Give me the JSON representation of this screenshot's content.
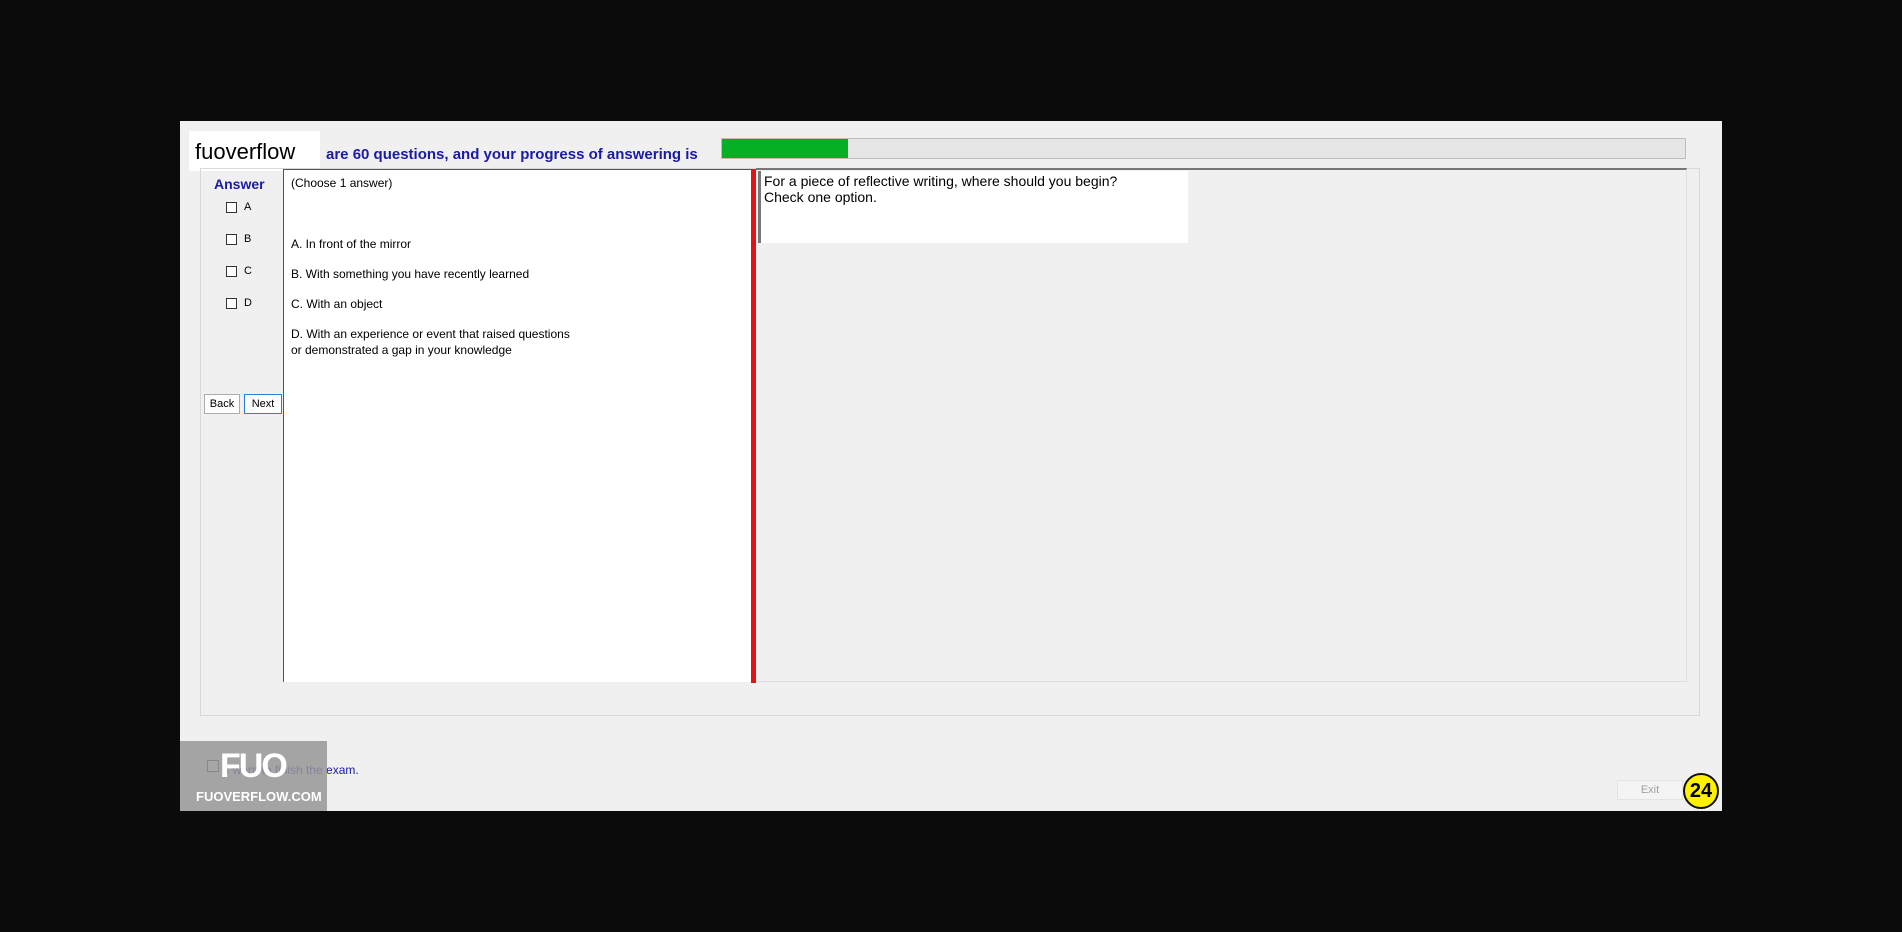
{
  "header": {
    "progress_text": "are 60 questions, and your progress of answering is",
    "progress_fraction": 0.131,
    "logo_text": "fuoverflow"
  },
  "answer": {
    "label": "Answer",
    "options": [
      "A",
      "B",
      "C",
      "D"
    ]
  },
  "nav": {
    "back_label": "Back",
    "next_label": "Next"
  },
  "question": {
    "instruction": "(Choose 1 answer)",
    "choices": [
      "A.  In front of the mirror",
      "B.  With something you have recently learned",
      "C.  With an object",
      "D.  With an experience or event that raised questions",
      "or demonstrated a gap in your knowledge"
    ]
  },
  "prompt": {
    "line1": "For a piece of reflective writing, where should you begin?",
    "line2": "Check one option."
  },
  "footer": {
    "finish_text": "I want to finish the exam.",
    "exit_label": "Exit",
    "badge": "24"
  },
  "watermark": {
    "logo": "FUO",
    "site": "FUOVERFLOW.COM"
  },
  "colors": {
    "progress": "#06b025",
    "splitter": "#e01414",
    "accent_text": "#1a1aa6",
    "badge": "#fff200"
  }
}
